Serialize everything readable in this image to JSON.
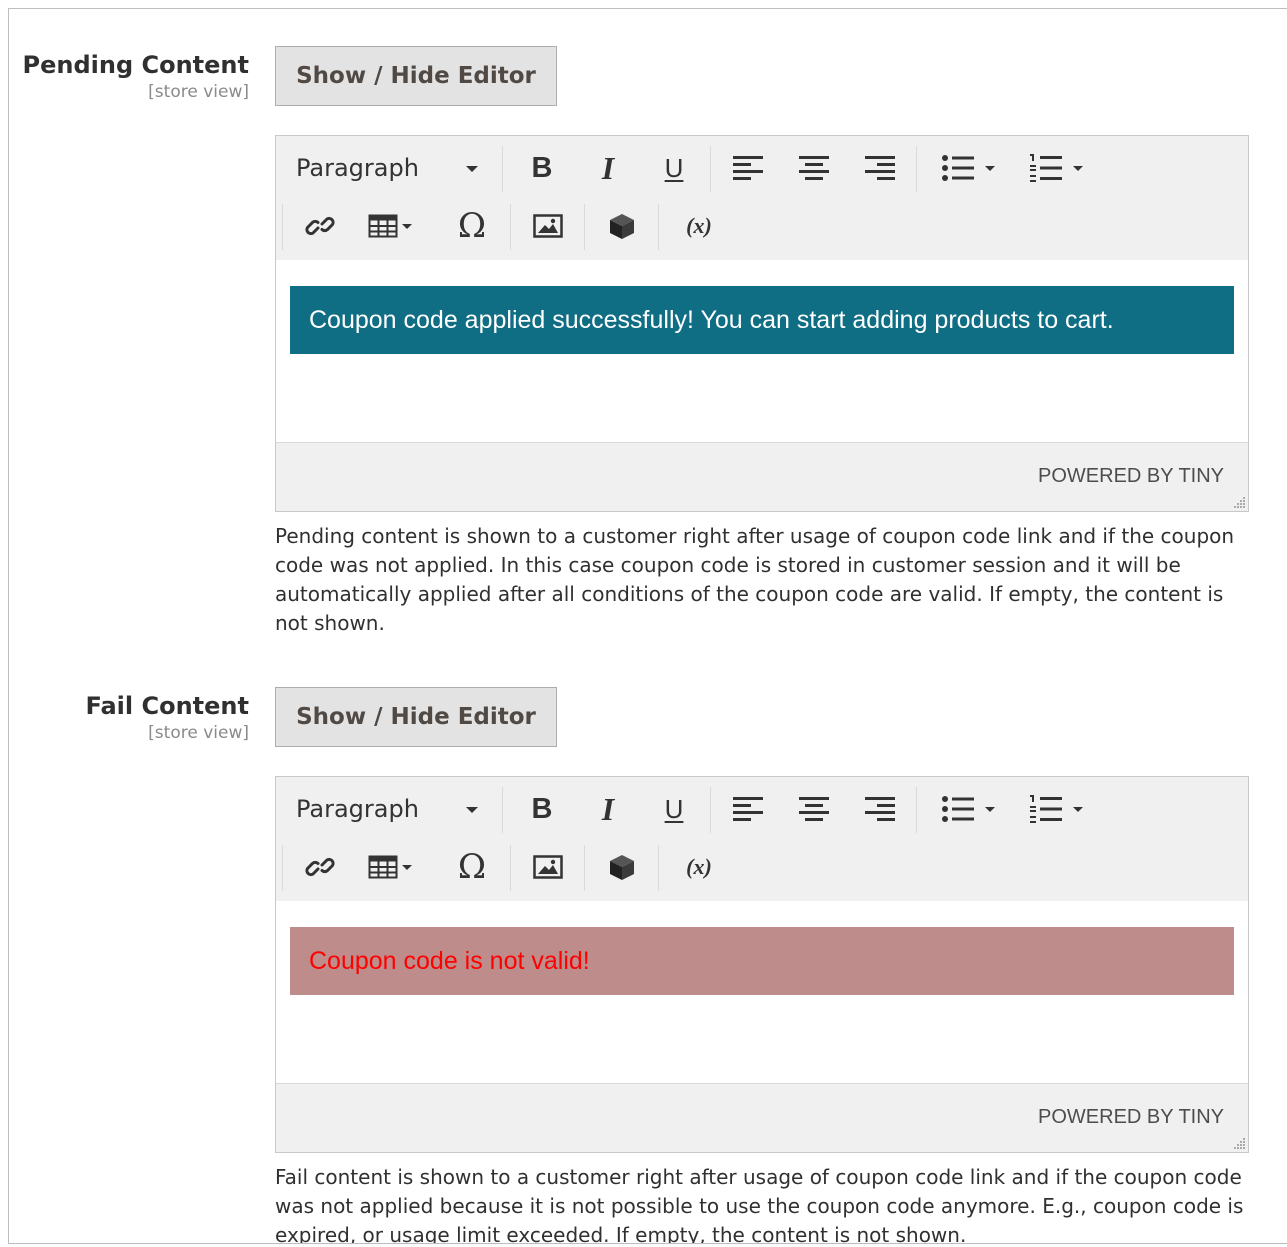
{
  "pending": {
    "label": "Pending Content",
    "scope": "[store view]",
    "toggle_label": "Show / Hide Editor",
    "format_select": "Paragraph",
    "content": "Coupon code applied successfully! You can start adding products to cart.",
    "content_style": {
      "background": "#0f6d84",
      "text_color": "#ffffff"
    },
    "powered_by": "POWERED BY TINY",
    "note": "Pending content is shown to a customer right after usage of coupon code link and if the coupon code was not applied. In this case coupon code is stored in customer session and it will be automatically applied after all conditions of the coupon code are valid. If empty, the content is not shown."
  },
  "fail": {
    "label": "Fail Content",
    "scope": "[store view]",
    "toggle_label": "Show / Hide Editor",
    "format_select": "Paragraph",
    "content": "Coupon code is not valid!",
    "content_style": {
      "background": "#bf8c8c",
      "text_color": "#ff0000"
    },
    "powered_by": "POWERED BY TINY",
    "note": "Fail content is shown to a customer right after usage of coupon code link and if the coupon code was not applied because it is not possible to use the coupon code anymore. E.g., coupon code is expired, or usage limit exceeded. If empty, the content is not shown."
  },
  "toolbar_icons": {
    "row1": [
      "bold-icon",
      "italic-icon",
      "underline-icon",
      "align-left-icon",
      "align-center-icon",
      "align-right-icon",
      "bullet-list-icon",
      "numbered-list-icon"
    ],
    "row2": [
      "link-icon",
      "table-icon",
      "special-character-icon",
      "image-icon",
      "widget-icon",
      "variable-icon"
    ]
  },
  "toolbar_glyphs": {
    "bold": "B",
    "italic": "I",
    "underline": "U",
    "omega": "Ω",
    "variable": "(x)"
  }
}
